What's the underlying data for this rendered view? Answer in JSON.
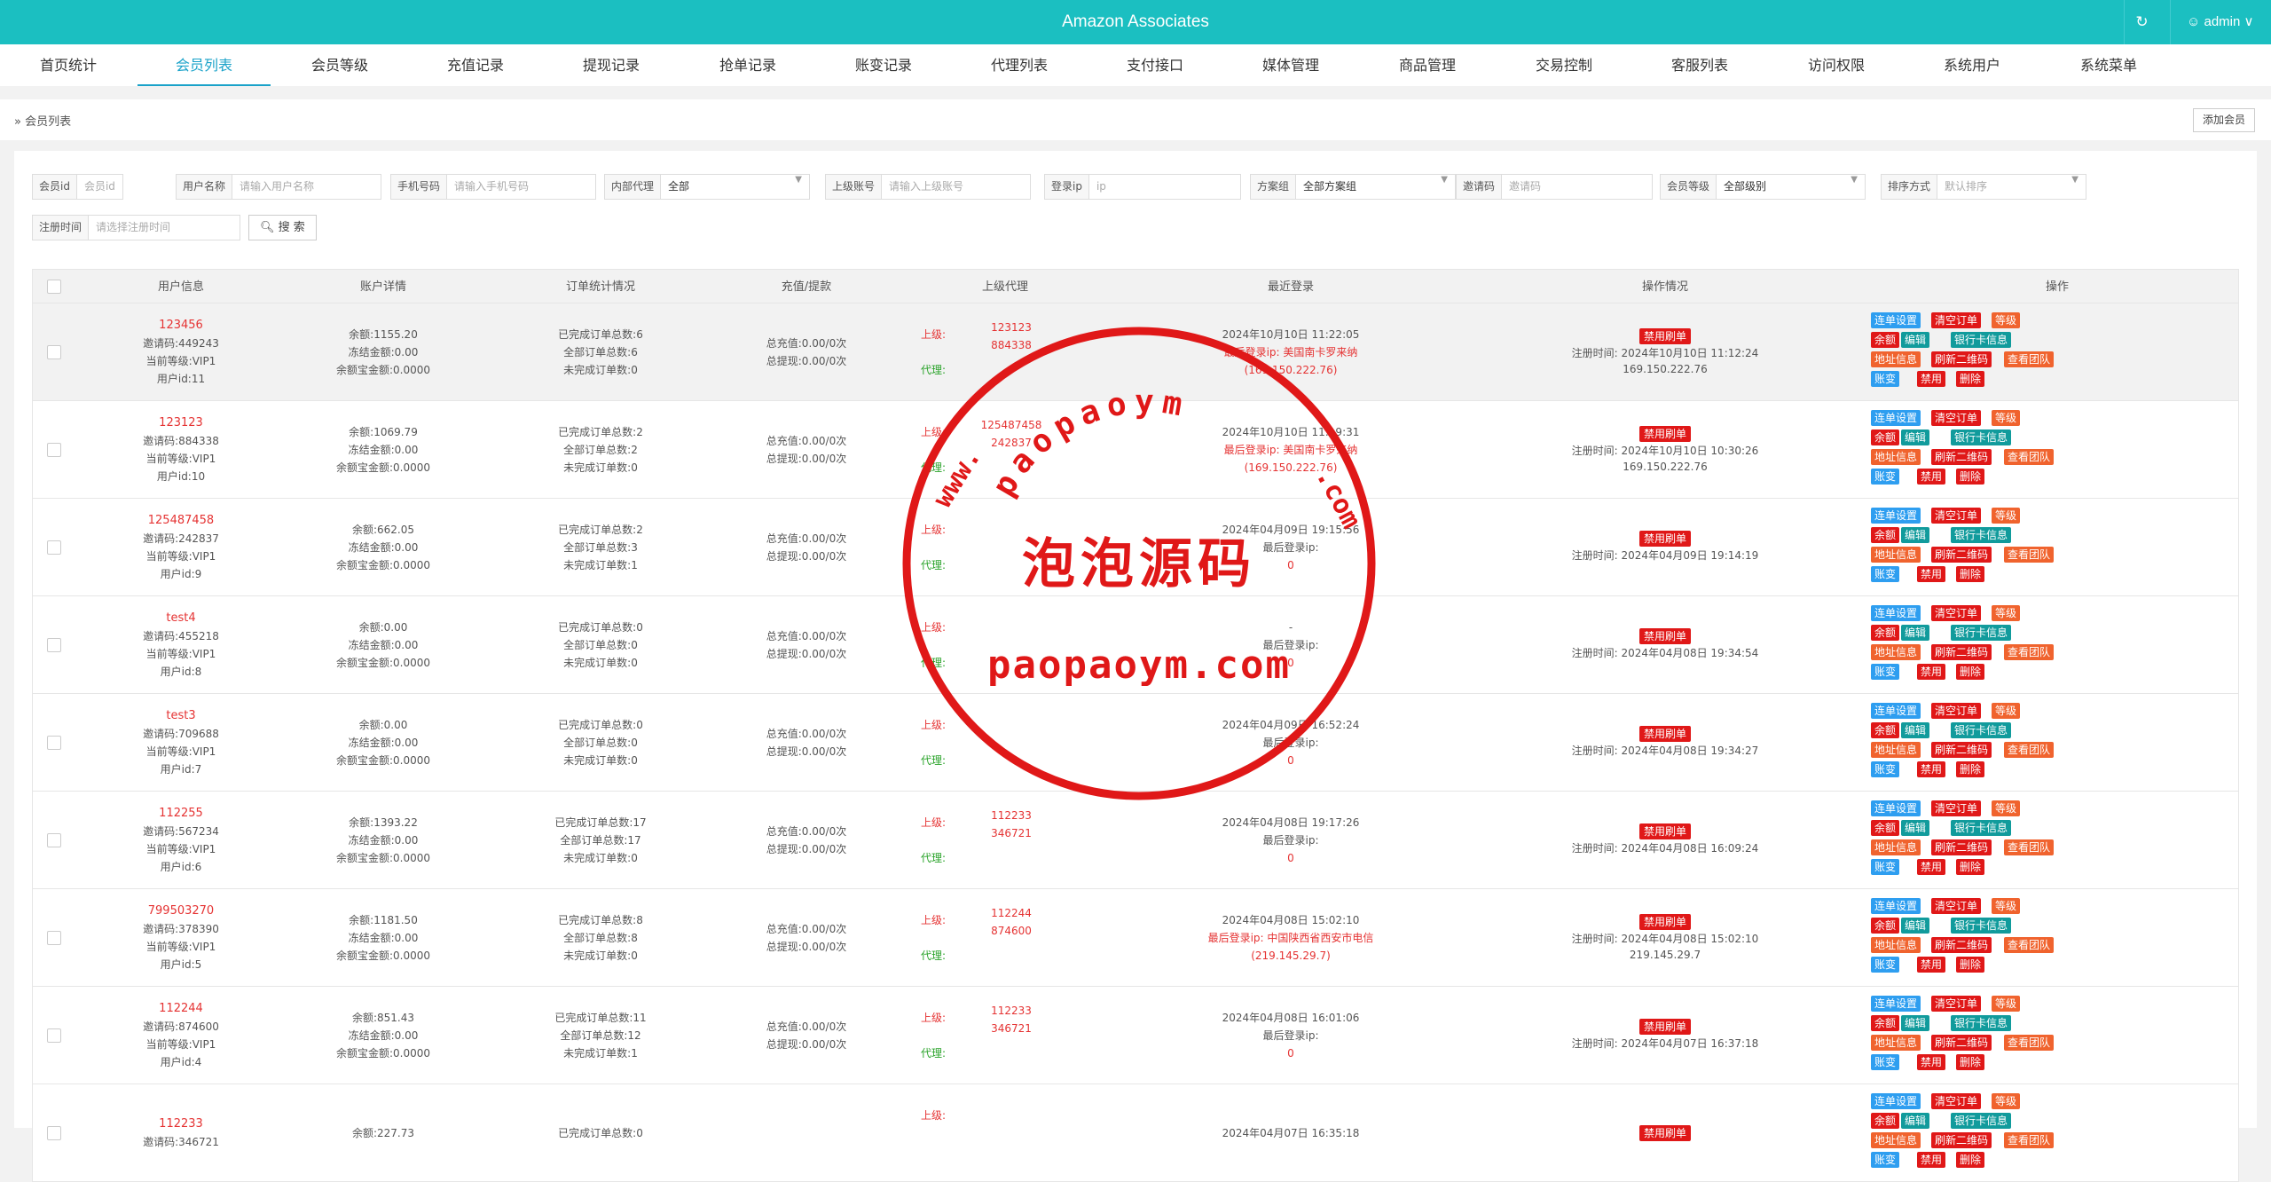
{
  "app": {
    "title": "Amazon Associates",
    "user": "admin"
  },
  "nav": [
    "首页统计",
    "会员列表",
    "会员等级",
    "充值记录",
    "提现记录",
    "抢单记录",
    "账变记录",
    "代理列表",
    "支付接口",
    "媒体管理",
    "商品管理",
    "交易控制",
    "客服列表",
    "访问权限",
    "系统用户",
    "系统菜单"
  ],
  "breadcrumb": "会员列表",
  "add_member": "添加会员",
  "filters": [
    {
      "label": "会员id",
      "value": "会员id"
    },
    {
      "label": "用户名称",
      "value": "请输入用户名称"
    },
    {
      "label": "手机号码",
      "value": "请输入手机号码"
    },
    {
      "label": "内部代理",
      "value": "全部"
    },
    {
      "label": "上级账号",
      "value": "请输入上级账号"
    },
    {
      "label": "登录ip",
      "value": "ip"
    },
    {
      "label": "方案组",
      "value": "全部方案组"
    },
    {
      "label": "邀请码",
      "value": "邀请码"
    },
    {
      "label": "会员等级",
      "value": "全部级别"
    },
    {
      "label": "排序方式",
      "value": "默认排序"
    },
    {
      "label": "注册时间",
      "value": "请选择注册时间"
    }
  ],
  "search_label": "搜 索",
  "columns": [
    "用户信息",
    "账户详情",
    "订单统计情况",
    "充值/提款",
    "上级代理",
    "最近登录",
    "操作情况",
    "操作"
  ],
  "labels": {
    "sup": "上级:",
    "agent": "代理:",
    "ban": "禁用刷单",
    "last_ip": "最后登录ip:",
    "reg": "注册时间:",
    "ops": [
      "连单设置",
      "清空订单",
      "等级",
      "余额",
      "编辑",
      "银行卡信息",
      "地址信息",
      "刷新二维码",
      "查看团队",
      "账变",
      "禁用",
      "删除"
    ]
  },
  "rows": [
    {
      "name": "123456",
      "invite": "邀请码:449243",
      "level": "当前等级:VIP1",
      "uid": "用户id:11",
      "bal": "余额:1155.20",
      "frozen": "冻结金额:0.00",
      "yeb": "余额宝金额:0.0000",
      "o1": "已完成订单总数:6",
      "o2": "全部订单总数:6",
      "o3": "未完成订单数:0",
      "rech": "总充值:0.00/0次",
      "wd": "总提现:0.00/0次",
      "sup1": "123123",
      "sup2": "884338",
      "login": "2024年10月10日 11:22:05",
      "ip": "最后登录ip: 美国南卡罗来纳",
      "ip2": "(169.150.222.76)",
      "regtime": "注册时间: 2024年10月10日 11:12:24",
      "regip": "169.150.222.76"
    },
    {
      "name": "123123",
      "invite": "邀请码:884338",
      "level": "当前等级:VIP1",
      "uid": "用户id:10",
      "bal": "余额:1069.79",
      "frozen": "冻结金额:0.00",
      "yeb": "余额宝金额:0.0000",
      "o1": "已完成订单总数:2",
      "o2": "全部订单总数:2",
      "o3": "未完成订单数:0",
      "rech": "总充值:0.00/0次",
      "wd": "总提现:0.00/0次",
      "sup1": "125487458",
      "sup2": "242837",
      "login": "2024年10月10日 11:19:31",
      "ip": "最后登录ip: 美国南卡罗来纳",
      "ip2": "(169.150.222.76)",
      "regtime": "注册时间: 2024年10月10日 10:30:26",
      "regip": "169.150.222.76"
    },
    {
      "name": "125487458",
      "invite": "邀请码:242837",
      "level": "当前等级:VIP1",
      "uid": "用户id:9",
      "bal": "余额:662.05",
      "frozen": "冻结金额:0.00",
      "yeb": "余额宝金额:0.0000",
      "o1": "已完成订单总数:2",
      "o2": "全部订单总数:3",
      "o3": "未完成订单数:1",
      "rech": "总充值:0.00/0次",
      "wd": "总提现:0.00/0次",
      "sup1": "",
      "sup2": "",
      "login": "2024年04月09日 19:15:56",
      "ip": "最后登录ip:",
      "ip2": "0",
      "regtime": "注册时间: 2024年04月09日 19:14:19",
      "regip": ""
    },
    {
      "name": "test4",
      "invite": "邀请码:455218",
      "level": "当前等级:VIP1",
      "uid": "用户id:8",
      "bal": "余额:0.00",
      "frozen": "冻结金额:0.00",
      "yeb": "余额宝金额:0.0000",
      "o1": "已完成订单总数:0",
      "o2": "全部订单总数:0",
      "o3": "未完成订单数:0",
      "rech": "总充值:0.00/0次",
      "wd": "总提现:0.00/0次",
      "sup1": "",
      "sup2": "",
      "login": "-",
      "ip": "最后登录ip:",
      "ip2": "0",
      "regtime": "注册时间: 2024年04月08日 19:34:54",
      "regip": ""
    },
    {
      "name": "test3",
      "invite": "邀请码:709688",
      "level": "当前等级:VIP1",
      "uid": "用户id:7",
      "bal": "余额:0.00",
      "frozen": "冻结金额:0.00",
      "yeb": "余额宝金额:0.0000",
      "o1": "已完成订单总数:0",
      "o2": "全部订单总数:0",
      "o3": "未完成订单数:0",
      "rech": "总充值:0.00/0次",
      "wd": "总提现:0.00/0次",
      "sup1": "",
      "sup2": "",
      "login": "2024年04月09日 16:52:24",
      "ip": "最后登录ip:",
      "ip2": "0",
      "regtime": "注册时间: 2024年04月08日 19:34:27",
      "regip": ""
    },
    {
      "name": "112255",
      "invite": "邀请码:567234",
      "level": "当前等级:VIP1",
      "uid": "用户id:6",
      "bal": "余额:1393.22",
      "frozen": "冻结金额:0.00",
      "yeb": "余额宝金额:0.0000",
      "o1": "已完成订单总数:17",
      "o2": "全部订单总数:17",
      "o3": "未完成订单数:0",
      "rech": "总充值:0.00/0次",
      "wd": "总提现:0.00/0次",
      "sup1": "112233",
      "sup2": "346721",
      "login": "2024年04月08日 19:17:26",
      "ip": "最后登录ip:",
      "ip2": "0",
      "regtime": "注册时间: 2024年04月08日 16:09:24",
      "regip": ""
    },
    {
      "name": "799503270",
      "invite": "邀请码:378390",
      "level": "当前等级:VIP1",
      "uid": "用户id:5",
      "bal": "余额:1181.50",
      "frozen": "冻结金额:0.00",
      "yeb": "余额宝金额:0.0000",
      "o1": "已完成订单总数:8",
      "o2": "全部订单总数:8",
      "o3": "未完成订单数:0",
      "rech": "总充值:0.00/0次",
      "wd": "总提现:0.00/0次",
      "sup1": "112244",
      "sup2": "874600",
      "login": "2024年04月08日 15:02:10",
      "ip": "最后登录ip: 中国陕西省西安市电信",
      "ip2": "(219.145.29.7)",
      "regtime": "注册时间: 2024年04月08日 15:02:10",
      "regip": "219.145.29.7"
    },
    {
      "name": "112244",
      "invite": "邀请码:874600",
      "level": "当前等级:VIP1",
      "uid": "用户id:4",
      "bal": "余额:851.43",
      "frozen": "冻结金额:0.00",
      "yeb": "余额宝金额:0.0000",
      "o1": "已完成订单总数:11",
      "o2": "全部订单总数:12",
      "o3": "未完成订单数:1",
      "rech": "总充值:0.00/0次",
      "wd": "总提现:0.00/0次",
      "sup1": "112233",
      "sup2": "346721",
      "login": "2024年04月08日 16:01:06",
      "ip": "最后登录ip:",
      "ip2": "0",
      "regtime": "注册时间: 2024年04月07日 16:37:18",
      "regip": ""
    },
    {
      "name": "112233",
      "invite": "邀请码:346721",
      "level": "",
      "uid": "",
      "bal": "余额:227.73",
      "frozen": "",
      "yeb": "",
      "o1": "已完成订单总数:0",
      "o2": "",
      "o3": "",
      "rech": "",
      "wd": "",
      "sup1": "",
      "sup2": "",
      "login": "2024年04月07日 16:35:18",
      "ip": "",
      "ip2": "",
      "regtime": "",
      "regip": ""
    }
  ],
  "watermark": {
    "arc_top": "paopaoym",
    "arc_side": "www.",
    "arc_right": ".com",
    "center": "泡泡源码",
    "bottom": "paopaoym.com"
  },
  "colors": {
    "primary": "#1bbfc1",
    "active_tab": "#1aa2c9",
    "danger": "#e01818",
    "link_red": "#e53333",
    "agent_green": "#2aa32a"
  }
}
